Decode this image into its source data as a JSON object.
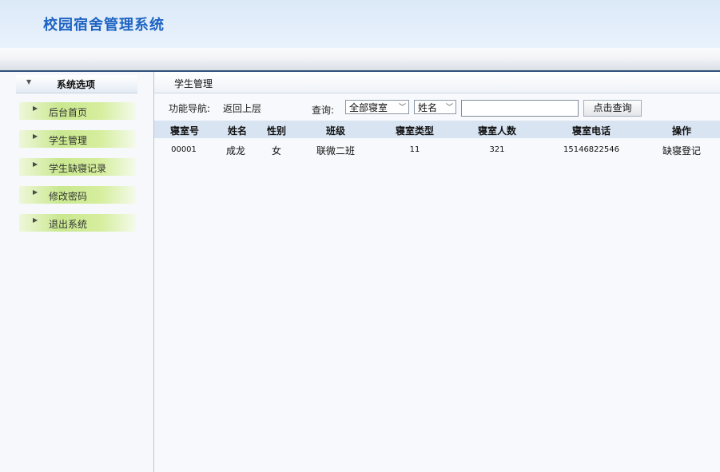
{
  "app": {
    "title": "校园宿舍管理系统"
  },
  "sidebar": {
    "title": "系统选项",
    "items": [
      {
        "label": "后台首页"
      },
      {
        "label": "学生管理"
      },
      {
        "label": "学生缺寝记录"
      },
      {
        "label": "修改密码"
      },
      {
        "label": "退出系统"
      }
    ]
  },
  "main": {
    "title": "学生管理",
    "nav_label": "功能导航:",
    "nav_back": "返回上层",
    "query_label": "查询:",
    "room_filter": "全部寝室",
    "field_filter": "姓名",
    "search_value": "",
    "search_button": "点击查询"
  },
  "table": {
    "headers": [
      "寝室号",
      "姓名",
      "性别",
      "班级",
      "寝室类型",
      "寝室人数",
      "寝室电话",
      "操作"
    ],
    "rows": [
      [
        "00001",
        "成龙",
        "女",
        "联微二班",
        "11",
        "321",
        "15146822546",
        "缺寝登记"
      ]
    ]
  },
  "colors": {
    "title_blue": "#1f64c2",
    "header_line": "#2f4f7c",
    "menu_green": "#c9e88f",
    "table_header_bg": "#d8e4f2"
  }
}
